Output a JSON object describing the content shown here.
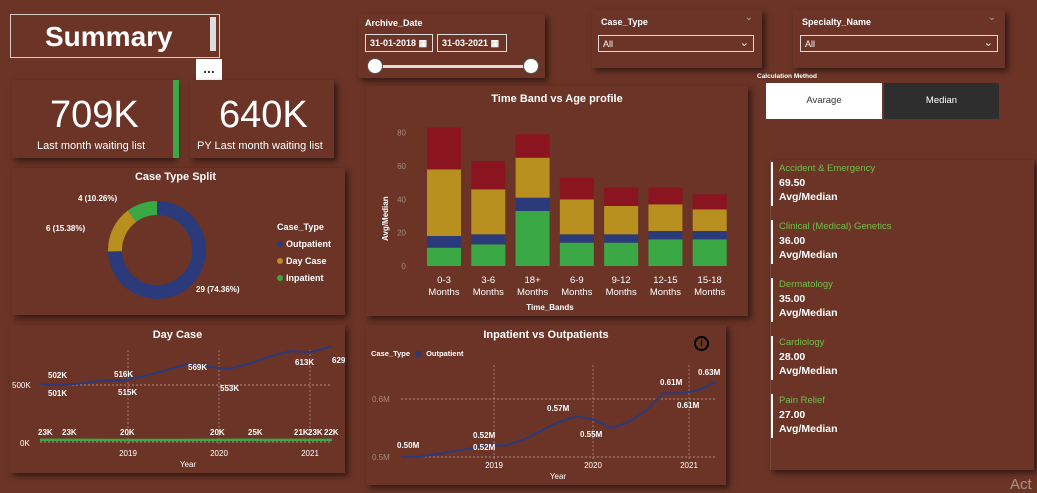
{
  "header": {
    "title": "Summary",
    "more_label": "..."
  },
  "kpis": [
    {
      "value": "709K",
      "label": "Last month waiting list"
    },
    {
      "value": "640K",
      "label": "PY Last month waiting list"
    }
  ],
  "archive_date": {
    "title": "Archive_Date",
    "start": "31-01-2018",
    "end": "31-03-2021"
  },
  "case_type_slicer": {
    "title": "Case_Type",
    "value": "All"
  },
  "specialty_slicer": {
    "title": "Specialty_Name",
    "value": "All"
  },
  "calc_method": {
    "title": "Calculation Method",
    "options": [
      "Avarage",
      "Median"
    ],
    "selected": "Median"
  },
  "case_type_split": {
    "title": "Case Type Split",
    "legend_title": "Case_Type",
    "chart_data": {
      "type": "pie",
      "slices": [
        {
          "name": "Outpatient",
          "value": 29,
          "label": "29 (74.36%)",
          "color": "#2b3a7a"
        },
        {
          "name": "Day Case",
          "value": 6,
          "label": "6 (15.38%)",
          "color": "#b8901f"
        },
        {
          "name": "Inpatient",
          "value": 4,
          "label": "4 (10.26%)",
          "color": "#3aa845"
        }
      ]
    }
  },
  "time_band": {
    "title": "Time Band vs Age profile",
    "chart_data": {
      "type": "bar",
      "stacked": true,
      "categories": [
        "0-3 Months",
        "3-6 Months",
        "18+ Months",
        "6-9 Months",
        "9-12 Months",
        "12-15 Months",
        "15-18 Months"
      ],
      "xlabel": "Time_Bands",
      "ylabel": "Avg/Median",
      "yticks": [
        "0",
        "20",
        "40",
        "60",
        "80"
      ],
      "ylim": [
        0,
        90
      ],
      "series": [
        {
          "color": "#3aa845",
          "values": [
            11,
            13,
            33,
            14,
            14,
            16,
            16
          ]
        },
        {
          "color": "#2b3a7a",
          "values": [
            7,
            6,
            8,
            5,
            5,
            5,
            5
          ]
        },
        {
          "color": "#b8901f",
          "values": [
            40,
            27,
            24,
            21,
            17,
            16,
            13
          ]
        },
        {
          "color": "#8a1420",
          "values": [
            25,
            17,
            14,
            13,
            11,
            10,
            9
          ]
        }
      ]
    }
  },
  "specialties": [
    {
      "name": "Accident & Emergency",
      "value": "69.50",
      "sub": "Avg/Median"
    },
    {
      "name": "Clinical (Medical) Genetics",
      "value": "36.00",
      "sub": "Avg/Median"
    },
    {
      "name": "Dermatology",
      "value": "35.00",
      "sub": "Avg/Median"
    },
    {
      "name": "Cardiology",
      "value": "28.00",
      "sub": "Avg/Median"
    },
    {
      "name": "Pain Relief",
      "value": "27.00",
      "sub": "Avg/Median"
    }
  ],
  "day_case": {
    "title": "Day Case",
    "chart_data": {
      "type": "line",
      "xlabel": "Year",
      "yticks": [
        "500K",
        "0K"
      ],
      "xticks": [
        "2019",
        "2020",
        "2021"
      ],
      "top_labels": [
        "502K",
        "501K",
        "516K",
        "515K",
        "569K",
        "553K",
        "613K",
        "629K"
      ],
      "bottom_labels": [
        "23K",
        "23K",
        "20K",
        "20K",
        "25K",
        "21K",
        "23K",
        "22K"
      ],
      "series": [
        {
          "color": "#2b3a7a",
          "values": [
            502,
            501,
            505,
            516,
            515,
            530,
            548,
            569,
            562,
            553,
            570,
            595,
            613,
            610,
            629
          ]
        },
        {
          "color": "#3aa845",
          "values": [
            23,
            23,
            22,
            21,
            20,
            21,
            21,
            20,
            22,
            23,
            25,
            21,
            22,
            23,
            22
          ]
        }
      ]
    }
  },
  "inpatient_outpatient": {
    "title": "Inpatient vs Outpatients",
    "legend_title": "Case_Type",
    "legend_series": "Outpatient",
    "info_icon": "i",
    "chart_data": {
      "type": "line",
      "xlabel": "Year",
      "yticks": [
        "0.6M",
        "0.5M"
      ],
      "xticks": [
        "2019",
        "2020",
        "2021"
      ],
      "labels": [
        "0.50M",
        "0.52M",
        "0.52M",
        "0.57M",
        "0.55M",
        "0.61M",
        "0.61M",
        "0.63M"
      ],
      "series": [
        {
          "name": "Outpatient",
          "color": "#2b3a7a",
          "values": [
            0.5,
            0.5,
            0.505,
            0.51,
            0.515,
            0.52,
            0.52,
            0.53,
            0.545,
            0.56,
            0.57,
            0.565,
            0.55,
            0.56,
            0.58,
            0.61,
            0.61,
            0.615,
            0.63
          ]
        }
      ]
    }
  },
  "watermark": "Act"
}
